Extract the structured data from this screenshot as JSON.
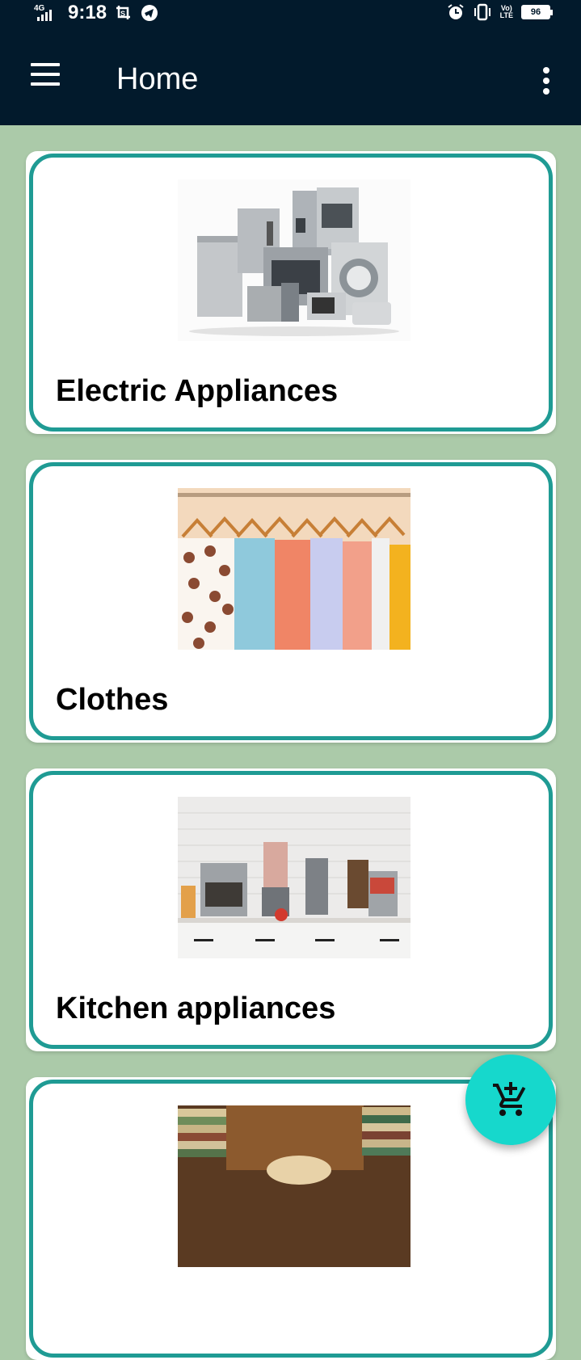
{
  "status_bar": {
    "network": "4G",
    "time": "9:18",
    "battery": "96",
    "left_icons": [
      "screenshot-icon",
      "telegram-icon"
    ],
    "right_icons": [
      "alarm-icon",
      "vibrate-icon",
      "volte-icon",
      "battery-icon"
    ],
    "volte_top": "Vo)",
    "volte_bottom": "LTE"
  },
  "app_bar": {
    "title": "Home",
    "menu_icon": "hamburger-menu-icon",
    "overflow_icon": "more-vertical-icon"
  },
  "categories": [
    {
      "label": "Electric Appliances",
      "image": "electric-appliances-image"
    },
    {
      "label": "Clothes",
      "image": "clothes-image"
    },
    {
      "label": "Kitchen appliances",
      "image": "kitchen-appliances-image"
    },
    {
      "label": "",
      "image": "books-image"
    }
  ],
  "fab": {
    "icon": "add-to-cart-icon"
  },
  "colors": {
    "app_bar": "#021a2c",
    "page_background": "#abcaa9",
    "card_border": "#1f9b94",
    "fab": "#16d8cc"
  }
}
